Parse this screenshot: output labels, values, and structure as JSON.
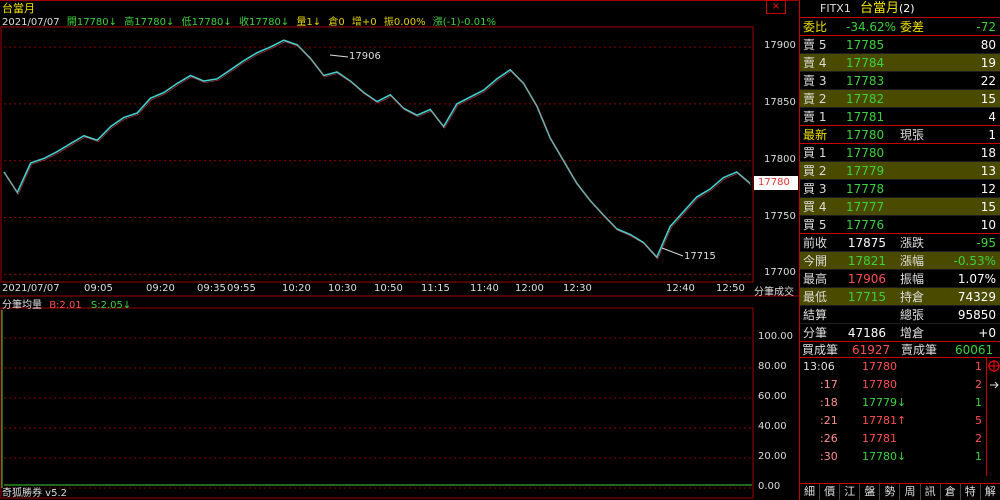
{
  "chart_title": "台當月",
  "ohlc_bar": {
    "date": "2021/07/07",
    "items": [
      {
        "text": "開17780↓",
        "color": "green"
      },
      {
        "text": "高17780↓",
        "color": "green"
      },
      {
        "text": "低17780↓",
        "color": "green"
      },
      {
        "text": "收17780↓",
        "color": "green"
      },
      {
        "text": "量1↓",
        "color": "white"
      },
      {
        "text": "倉0",
        "color": "white"
      },
      {
        "text": "增+0",
        "color": "white"
      },
      {
        "text": "振0.00%",
        "color": "white"
      },
      {
        "text": "漲(-1)-0.01%",
        "color": "green"
      }
    ]
  },
  "close_button_label": "×",
  "current_price_tag": "17780",
  "high_label": "17906",
  "low_label": "17715",
  "time_axis_title": "分筆成交",
  "volume_panel": {
    "title": "分筆均量",
    "b_label": "B:2.01",
    "s_label": "S:2.05↓"
  },
  "footer_brand": "奇狐勝券 v5.2",
  "chart_data": {
    "type": "line",
    "x": [
      "2021/07/07",
      "09:05",
      "09:20",
      "09:35",
      "09:55",
      "10:20",
      "10:30",
      "10:50",
      "11:15",
      "11:40",
      "12:00",
      "12:30",
      "12:40",
      "12:50"
    ],
    "y_ticks": [
      17900,
      17850,
      17800,
      17750,
      17700
    ],
    "ylim": [
      17695,
      17915
    ],
    "price_series": [
      17790,
      17772,
      17798,
      17802,
      17808,
      17815,
      17822,
      17818,
      17830,
      17838,
      17842,
      17855,
      17860,
      17868,
      17875,
      17870,
      17872,
      17880,
      17888,
      17895,
      17900,
      17906,
      17902,
      17890,
      17875,
      17878,
      17870,
      17860,
      17852,
      17858,
      17846,
      17840,
      17845,
      17830,
      17850,
      17856,
      17862,
      17872,
      17880,
      17868,
      17848,
      17820,
      17800,
      17780,
      17765,
      17752,
      17740,
      17735,
      17728,
      17715,
      17742,
      17755,
      17768,
      17775,
      17785,
      17790,
      17780
    ],
    "volume_ticks": [
      "100.00",
      "80.00",
      "60.00",
      "40.00",
      "20.00",
      "0.00"
    ],
    "volume_ylim": [
      0,
      100
    ],
    "volume_values": [
      2,
      2,
      2,
      2
    ]
  },
  "panel": {
    "symbol": "FITX1",
    "name": "台當月",
    "name_suffix": "(2)",
    "ratio_row": {
      "l1": "委比",
      "v1": "-34.62%",
      "l2": "委差",
      "v2": "-72"
    },
    "asks": [
      {
        "label": "賣 5",
        "price": "17785",
        "qty": "80"
      },
      {
        "label": "賣 4",
        "price": "17784",
        "qty": "19"
      },
      {
        "label": "賣 3",
        "price": "17783",
        "qty": "22"
      },
      {
        "label": "賣 2",
        "price": "17782",
        "qty": "15"
      },
      {
        "label": "賣 1",
        "price": "17781",
        "qty": "4"
      }
    ],
    "last_row": {
      "label": "最新",
      "price": "17780",
      "label2": "現張",
      "qty": "1"
    },
    "bids": [
      {
        "label": "買 1",
        "price": "17780",
        "qty": "18"
      },
      {
        "label": "買 2",
        "price": "17779",
        "qty": "13"
      },
      {
        "label": "買 3",
        "price": "17778",
        "qty": "12"
      },
      {
        "label": "買 4",
        "price": "17777",
        "qty": "15"
      },
      {
        "label": "買 5",
        "price": "17776",
        "qty": "10"
      }
    ],
    "stats": [
      {
        "l1": "前收",
        "v1": "17875",
        "c1": "white",
        "l2": "漲跌",
        "v2": "-95",
        "c2": "green"
      },
      {
        "l1": "今開",
        "v1": "17821",
        "c1": "green",
        "l2": "漲幅",
        "v2": "-0.53%",
        "c2": "green"
      },
      {
        "l1": "最高",
        "v1": "17906",
        "c1": "red",
        "l2": "振幅",
        "v2": "1.07%",
        "c2": "white"
      },
      {
        "l1": "最低",
        "v1": "17715",
        "c1": "green",
        "l2": "持倉",
        "v2": "74329",
        "c2": "white"
      },
      {
        "l1": "結算",
        "v1": "",
        "c1": "white",
        "l2": "總張",
        "v2": "95850",
        "c2": "white"
      },
      {
        "l1": "分筆",
        "v1": "47186",
        "c1": "white",
        "l2": "增倉",
        "v2": "+0",
        "c2": "white"
      }
    ],
    "summary": {
      "buy_label": "買成筆",
      "buy_value": "61927",
      "sell_label": "賣成筆",
      "sell_value": "60061"
    },
    "ticks": [
      {
        "time": "13:06",
        "price": "17780",
        "arrow": "",
        "qty": "1",
        "color": "red"
      },
      {
        "time": ":17",
        "price": "17780",
        "arrow": "",
        "qty": "2",
        "color": "red"
      },
      {
        "time": ":18",
        "price": "17779",
        "arrow": "↓",
        "qty": "1",
        "color": "green"
      },
      {
        "time": ":21",
        "price": "17781",
        "arrow": "↑",
        "qty": "5",
        "color": "red"
      },
      {
        "time": ":26",
        "price": "17781",
        "arrow": "",
        "qty": "2",
        "color": "red"
      },
      {
        "time": ":30",
        "price": "17780",
        "arrow": "↓",
        "qty": "1",
        "color": "green"
      }
    ],
    "tabs": [
      "細",
      "價",
      "江",
      "盤",
      "勢",
      "周",
      "訊",
      "倉",
      "特",
      "解"
    ]
  },
  "colors": {
    "up": "#ff5050",
    "down": "#3cd23c",
    "grid": "#8b0000",
    "line": "#3fd0d0",
    "accent": "#f0e000"
  }
}
